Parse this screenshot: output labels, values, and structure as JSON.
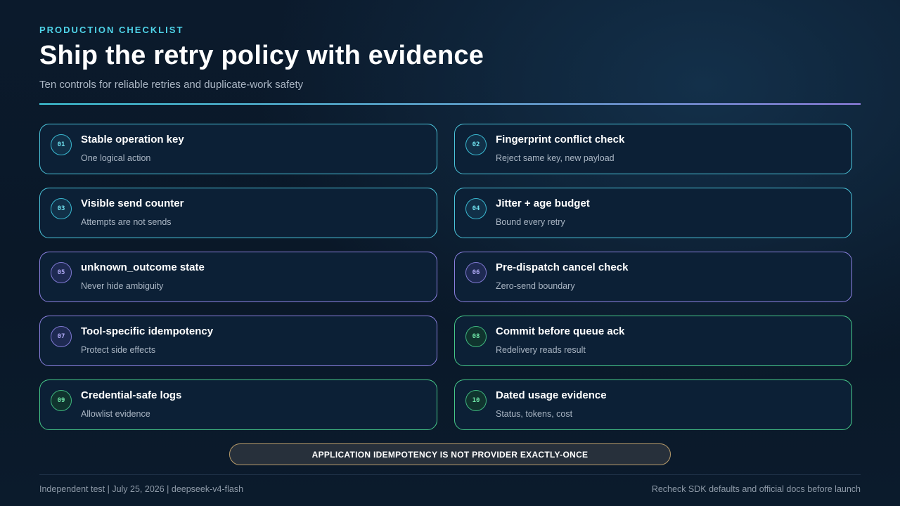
{
  "header": {
    "eyebrow": "PRODUCTION CHECKLIST",
    "title": "Ship the retry policy with evidence",
    "subtitle": "Ten controls for reliable retries and duplicate-work safety"
  },
  "checklist": [
    {
      "num": "01",
      "title": "Stable operation key",
      "sub": "One logical action"
    },
    {
      "num": "02",
      "title": "Fingerprint conflict check",
      "sub": "Reject same key, new payload"
    },
    {
      "num": "03",
      "title": "Visible send counter",
      "sub": "Attempts are not sends"
    },
    {
      "num": "04",
      "title": "Jitter + age budget",
      "sub": "Bound every retry"
    },
    {
      "num": "05",
      "title": "unknown_outcome state",
      "sub": "Never hide ambiguity"
    },
    {
      "num": "06",
      "title": "Pre-dispatch cancel check",
      "sub": "Zero-send boundary"
    },
    {
      "num": "07",
      "title": "Tool-specific idempotency",
      "sub": "Protect side effects"
    },
    {
      "num": "08",
      "title": "Commit before queue ack",
      "sub": "Redelivery reads result"
    },
    {
      "num": "09",
      "title": "Credential-safe logs",
      "sub": "Allowlist evidence"
    },
    {
      "num": "10",
      "title": "Dated usage evidence",
      "sub": "Status, tokens, cost"
    }
  ],
  "banner": "APPLICATION IDEMPOTENCY IS NOT PROVIDER EXACTLY-ONCE",
  "footer": {
    "left": "Independent test | July 25, 2026 | deepseek-v4-flash",
    "right": "Recheck SDK defaults and official docs before launch"
  },
  "colors": {
    "accent_cyan": "#4fd3e8",
    "accent_violet": "#8b80e0",
    "accent_green": "#46c98a",
    "banner_border": "#b69a6a"
  }
}
